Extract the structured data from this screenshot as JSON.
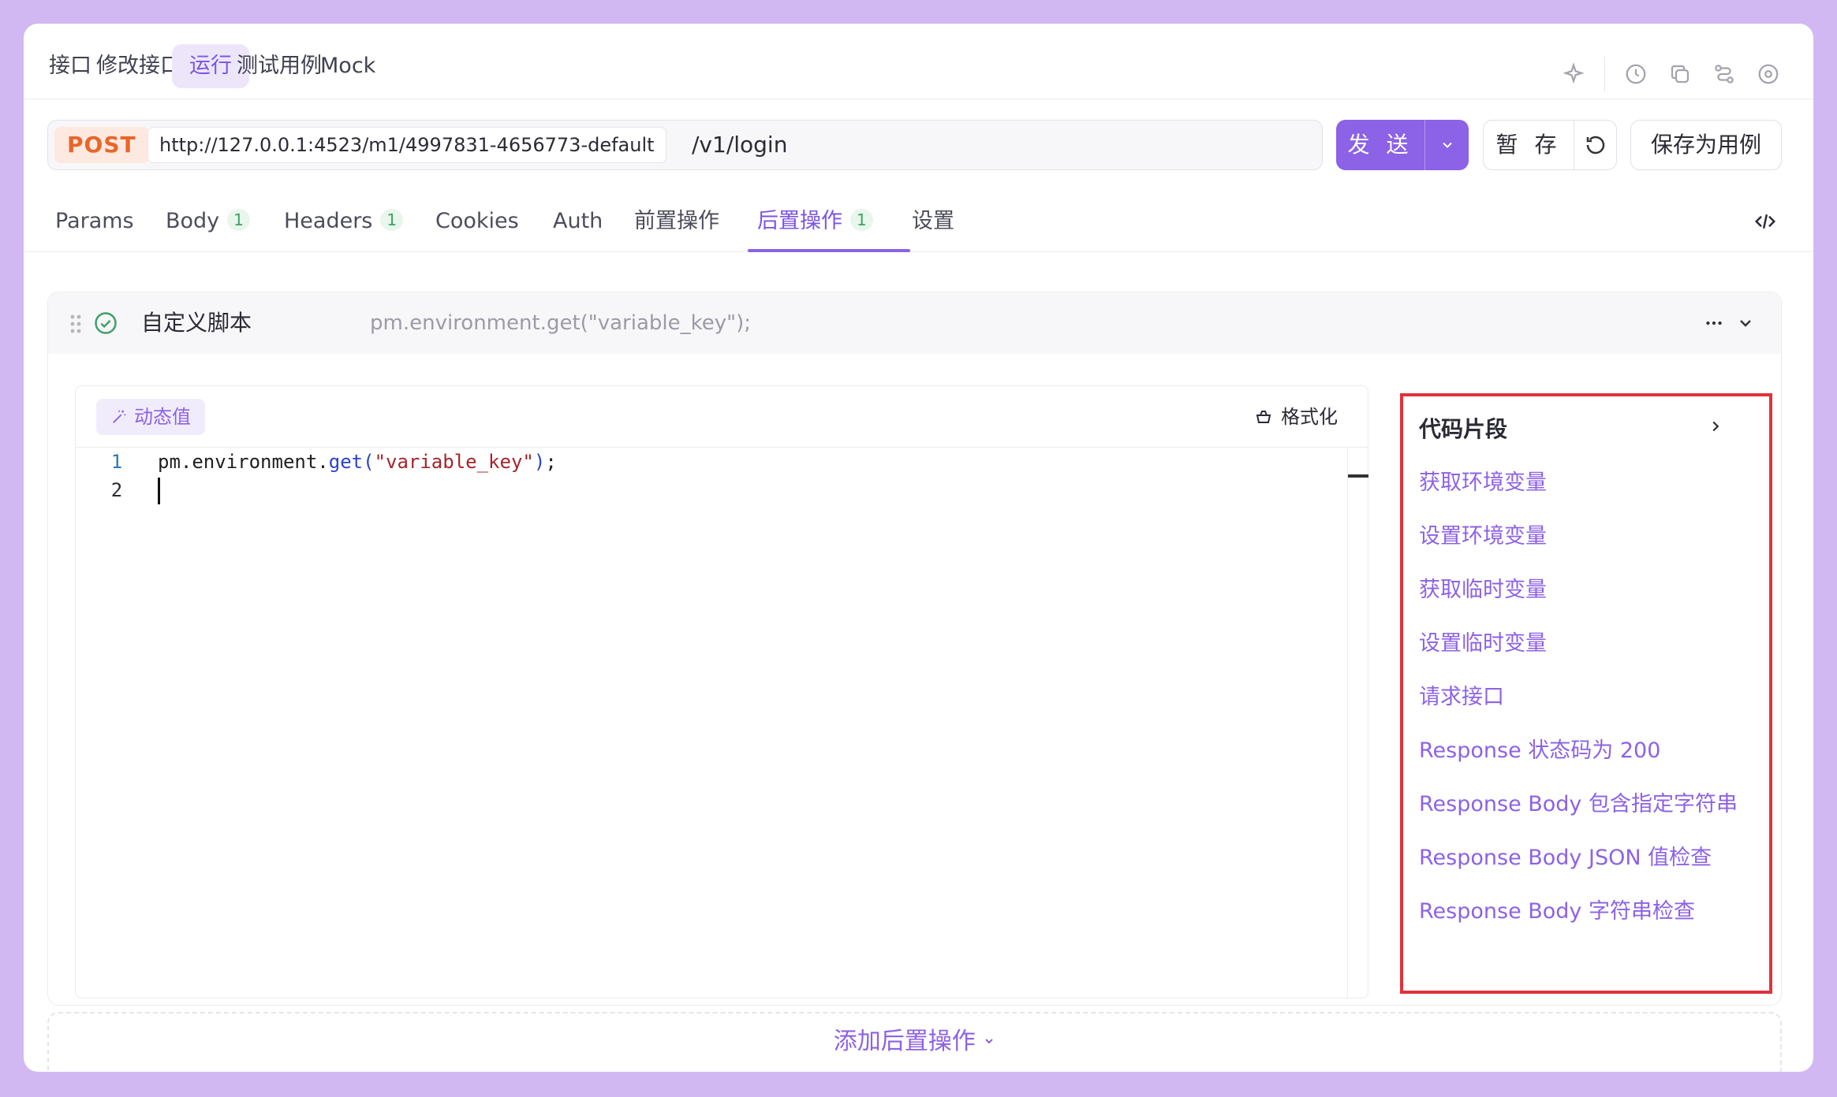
{
  "top_tabs": [
    {
      "label": "接口"
    },
    {
      "label": "修改接口"
    },
    {
      "label": "运行"
    },
    {
      "label": "测试用例"
    },
    {
      "label": "Mock"
    }
  ],
  "active_top_tab": "运行",
  "request": {
    "method": "POST",
    "base_url": "http://127.0.0.1:4523/m1/4997831-4656773-default",
    "path": "/v1/login"
  },
  "actions": {
    "send_label": "发 送",
    "stash_label": "暂 存",
    "save_as_case_label": "保存为用例"
  },
  "request_tabs": [
    {
      "label": "Params",
      "badge": ""
    },
    {
      "label": "Body",
      "badge": "1"
    },
    {
      "label": "Headers",
      "badge": "1"
    },
    {
      "label": "Cookies",
      "badge": ""
    },
    {
      "label": "Auth",
      "badge": ""
    },
    {
      "label": "前置操作",
      "badge": ""
    },
    {
      "label": "后置操作",
      "badge": "1"
    },
    {
      "label": "设置",
      "badge": ""
    }
  ],
  "active_request_tab": "后置操作",
  "script": {
    "title": "自定义脚本",
    "preview": "pm.environment.get(\"variable_key\");",
    "dynamic_value_label": "动态值",
    "format_label": "格式化",
    "line_numbers": [
      "1",
      "2"
    ],
    "code": {
      "obj": "pm.environment.",
      "fn": "get",
      "open": "(",
      "arg": "\"variable_key\"",
      "close": ")",
      "end": ";"
    }
  },
  "snippets": {
    "title": "代码片段",
    "items": [
      "获取环境变量",
      "设置环境变量",
      "获取临时变量",
      "设置临时变量",
      "请求接口",
      "Response 状态码为 200",
      "Response Body 包含指定字符串",
      "Response Body JSON 值检查",
      "Response Body 字符串检查"
    ]
  },
  "add_post_action_label": "添加后置操作",
  "colors": {
    "accent": "#8c62e6",
    "method_post": "#e7662a",
    "badge_green": "#3ea067",
    "highlight_border": "#e0323a"
  }
}
